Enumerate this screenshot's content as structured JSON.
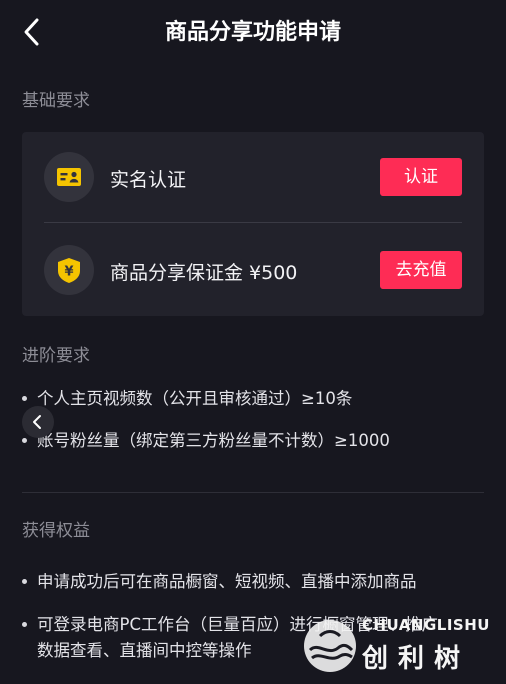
{
  "header": {
    "title": "商品分享功能申请"
  },
  "basic": {
    "label": "基础要求",
    "items": [
      {
        "label": "实名认证",
        "button": "认证",
        "icon": "id-card-icon"
      },
      {
        "label": "商品分享保证金 ¥500",
        "button": "去充值",
        "icon": "yen-shield-icon"
      }
    ]
  },
  "advanced": {
    "label": "进阶要求",
    "items": [
      "个人主页视频数（公开且审核通过）≥10条",
      "账号粉丝量（绑定第三方粉丝量不计数）≥1000"
    ]
  },
  "benefits": {
    "label": "获得权益",
    "items": [
      "申请成功后可在商品橱窗、短视频、直播中添加商品",
      "可登录电商PC工作台（巨量百应）进行橱窗管理、推广",
      "数据查看、直播间中控等操作"
    ]
  },
  "watermark": {
    "en": "CHUANGLISHU",
    "cn": "创利树"
  },
  "colors": {
    "accent": "#fe2c55",
    "badge_yellow": "#f5c400",
    "background": "#17171f",
    "card": "#22222b"
  }
}
